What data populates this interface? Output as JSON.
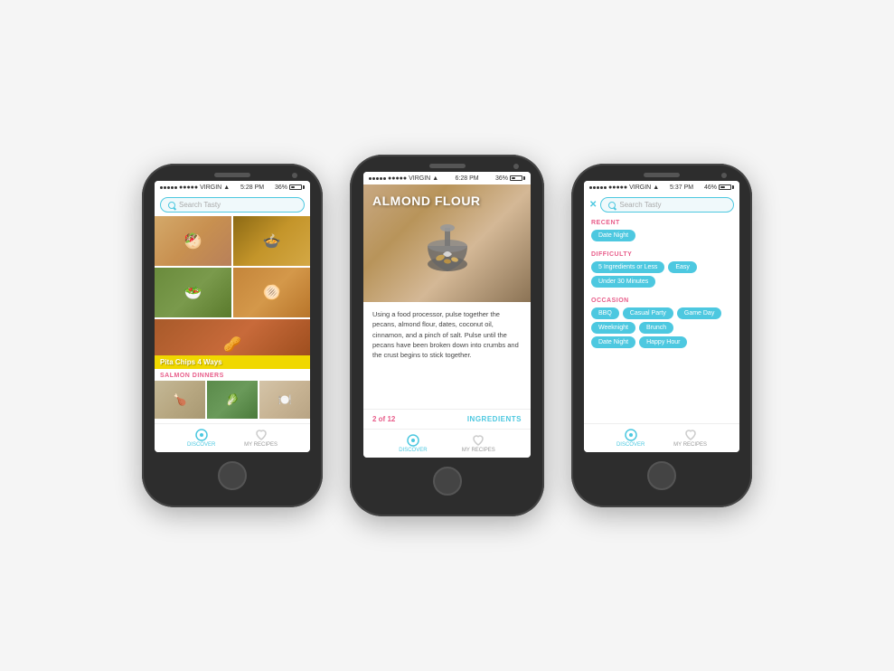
{
  "page": {
    "bg_color": "#f5f5f5"
  },
  "phones": [
    {
      "id": "phone1",
      "status_bar": {
        "carrier": "●●●●● VIRGIN",
        "time": "5:28 PM",
        "battery": "36%"
      },
      "search_placeholder": "Search Tasty",
      "section_label": "SALMON DINNERS",
      "pita_label": "Pita Chips 4 Ways",
      "nav": {
        "discover": "DISCOVER",
        "my_recipes": "MY RECIPES"
      }
    },
    {
      "id": "phone2",
      "status_bar": {
        "carrier": "●●●●● VIRGIN",
        "time": "6:28 PM",
        "battery": "36%"
      },
      "recipe_title": "ALMOND FLOUR",
      "recipe_text": "Using a food processor, pulse together the pecans, almond flour, dates, coconut oil, cinnamon, and a pinch of salt. Pulse until the pecans have been broken down into crumbs and the crust begins to stick together.",
      "page_indicator": "2 of 12",
      "ingredients_btn": "INGREDIENTS"
    },
    {
      "id": "phone3",
      "status_bar": {
        "carrier": "●●●●● VIRGIN",
        "time": "5:37 PM",
        "battery": "46%"
      },
      "search_placeholder": "Search Tasty",
      "sections": {
        "recent": {
          "title": "RECENT",
          "tags": [
            "Date Night"
          ]
        },
        "difficulty": {
          "title": "DIFFICULTY",
          "tags": [
            "5 Ingredients or Less",
            "Easy",
            "Under 30 Minutes"
          ]
        },
        "occasion": {
          "title": "OCCASION",
          "tags": [
            "BBQ",
            "Casual Party",
            "Game Day",
            "Weeknight",
            "Brunch",
            "Date Night",
            "Happy Hour"
          ]
        }
      },
      "nav": {
        "discover": "DISCOVER",
        "my_recipes": "MY RECIPES"
      }
    }
  ]
}
